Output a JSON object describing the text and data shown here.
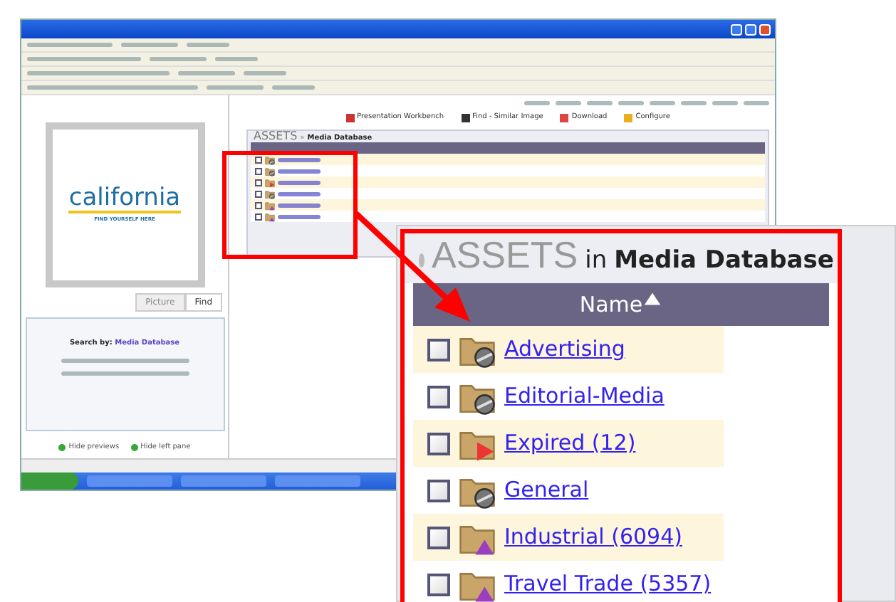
{
  "logo": {
    "wordmark": "california",
    "tagline": "FIND YOURSELF HERE"
  },
  "toolbar": [
    {
      "label": "Presentation Workbench",
      "kind": "workbench"
    },
    {
      "label": "Find - Similar Image",
      "kind": "binoculars"
    },
    {
      "label": "Download",
      "kind": "download"
    },
    {
      "label": "Configure",
      "kind": "configure"
    }
  ],
  "assets_panel": {
    "title": "ASSETS",
    "separator": "»",
    "context": "Media Database"
  },
  "preview_tabs": [
    {
      "label": "Picture",
      "selected": false
    },
    {
      "label": "Find",
      "selected": true
    }
  ],
  "search": {
    "label": "Search by:",
    "value": "Media Database"
  },
  "bottom_links": [
    {
      "label": "Hide previews"
    },
    {
      "label": "Hide left pane"
    }
  ],
  "callout": {
    "title": "ASSETS",
    "title_in": "in",
    "title_context": "Media Database",
    "column": "Name",
    "rows": [
      {
        "name": "Advertising",
        "kind": "blocked",
        "checked": false
      },
      {
        "name": "Editorial-Media",
        "kind": "blocked",
        "checked": false
      },
      {
        "name": "Expired (12)",
        "kind": "expired",
        "checked": false
      },
      {
        "name": "General",
        "kind": "blocked",
        "checked": false
      },
      {
        "name": "Industrial (6094)",
        "kind": "restricted",
        "checked": false
      },
      {
        "name": "Travel Trade (5357)",
        "kind": "restricted",
        "checked": false
      }
    ]
  }
}
